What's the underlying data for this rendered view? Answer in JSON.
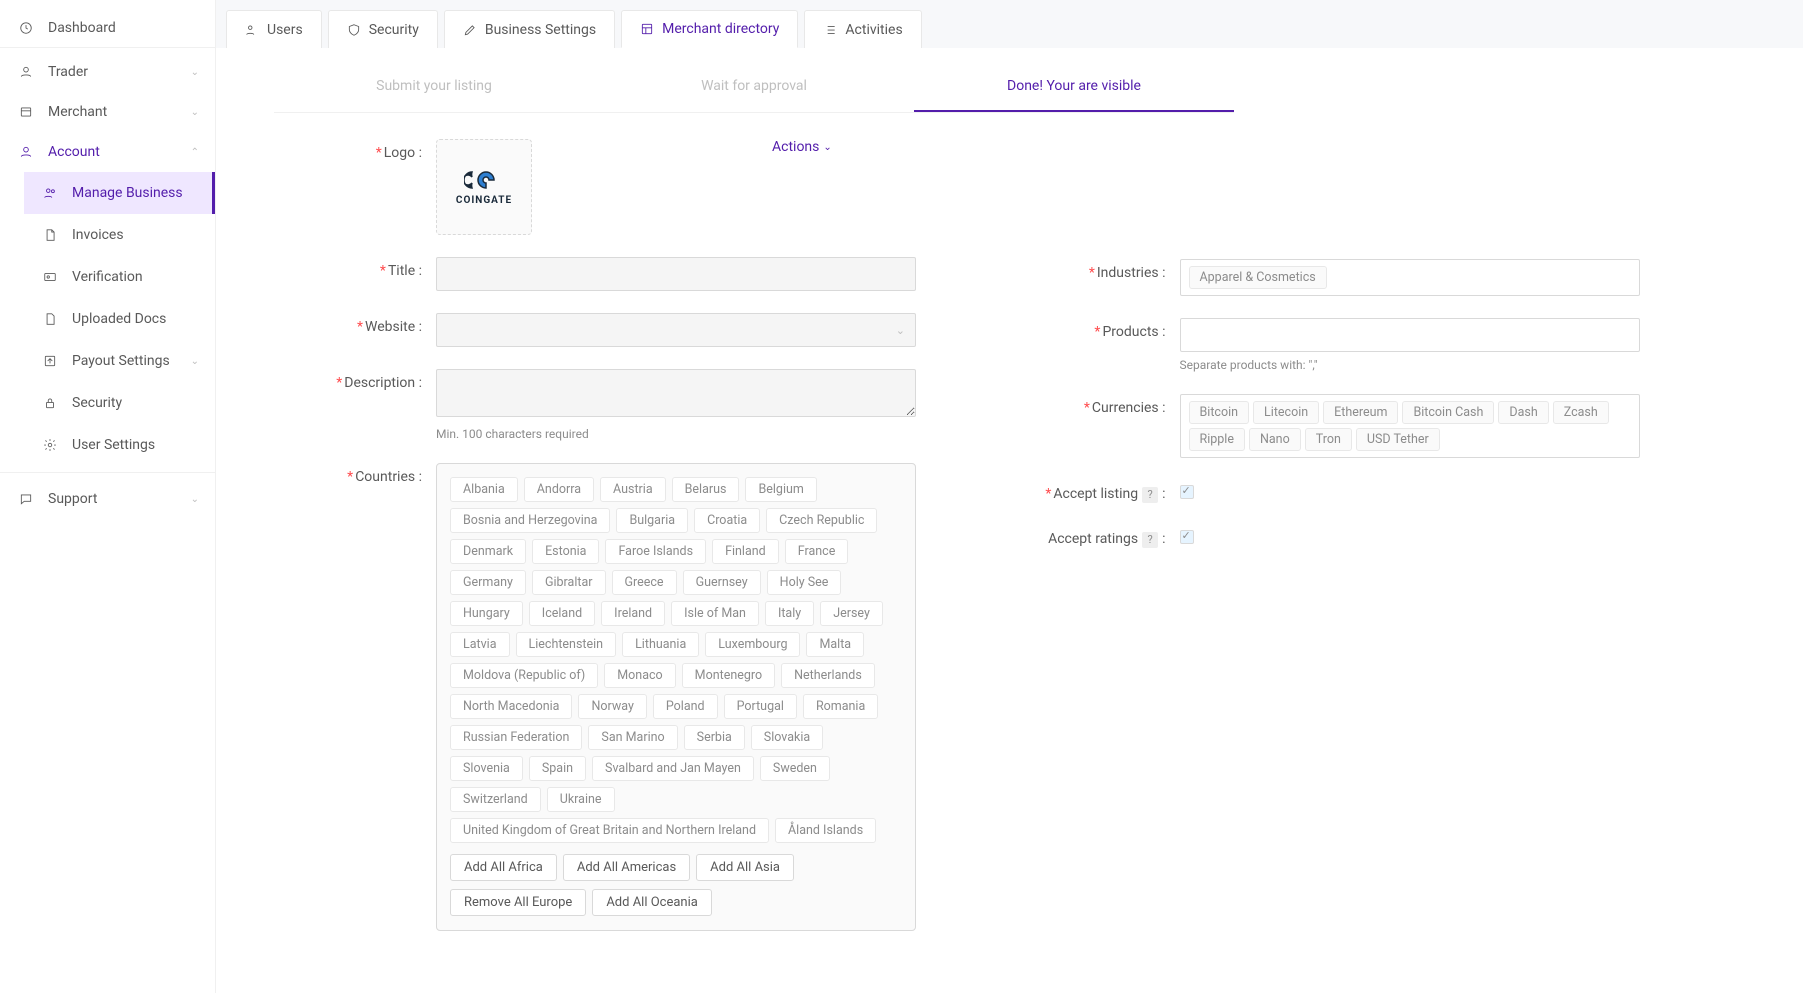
{
  "sidebar": {
    "dashboard": "Dashboard",
    "trader": "Trader",
    "merchant": "Merchant",
    "account": "Account",
    "sub": {
      "manage": "Manage Business",
      "invoices": "Invoices",
      "verification": "Verification",
      "uploaded": "Uploaded Docs",
      "payout": "Payout Settings",
      "security": "Security",
      "user": "User Settings"
    },
    "support": "Support"
  },
  "tabs": {
    "users": "Users",
    "security": "Security",
    "business": "Business Settings",
    "directory": "Merchant directory",
    "activities": "Activities"
  },
  "steps": {
    "submit": "Submit your listing",
    "wait": "Wait for approval",
    "done": "Done! Your are visible"
  },
  "form": {
    "logo": "Logo",
    "logo_text": "COINGATE",
    "actions": "Actions",
    "title": "Title",
    "website": "Website",
    "description": "Description",
    "desc_hint": "Min. 100 characters required",
    "countries_lbl": "Countries",
    "countries": [
      "Albania",
      "Andorra",
      "Austria",
      "Belarus",
      "Belgium",
      "Bosnia and Herzegovina",
      "Bulgaria",
      "Croatia",
      "Czech Republic",
      "Denmark",
      "Estonia",
      "Faroe Islands",
      "Finland",
      "France",
      "Germany",
      "Gibraltar",
      "Greece",
      "Guernsey",
      "Holy See",
      "Hungary",
      "Iceland",
      "Ireland",
      "Isle of Man",
      "Italy",
      "Jersey",
      "Latvia",
      "Liechtenstein",
      "Lithuania",
      "Luxembourg",
      "Malta",
      "Moldova (Republic of)",
      "Monaco",
      "Montenegro",
      "Netherlands",
      "North Macedonia",
      "Norway",
      "Poland",
      "Portugal",
      "Romania",
      "Russian Federation",
      "San Marino",
      "Serbia",
      "Slovakia",
      "Slovenia",
      "Spain",
      "Svalbard and Jan Mayen",
      "Sweden",
      "Switzerland",
      "Ukraine",
      "United Kingdom of Great Britain and Northern Ireland",
      "Åland Islands"
    ],
    "region_btns": [
      "Add All Africa",
      "Add All Americas",
      "Add All Asia",
      "Remove All Europe",
      "Add All Oceania"
    ],
    "industries_lbl": "Industries",
    "industries": [
      "Apparel & Cosmetics"
    ],
    "products_lbl": "Products",
    "products_hint": "Separate products with: \",\"",
    "currencies_lbl": "Currencies",
    "currencies": [
      "Bitcoin",
      "Litecoin",
      "Ethereum",
      "Bitcoin Cash",
      "Dash",
      "Zcash",
      "Ripple",
      "Nano",
      "Tron",
      "USD Tether"
    ],
    "accept_listing": "Accept listing",
    "accept_ratings": "Accept ratings",
    "help": "?"
  }
}
